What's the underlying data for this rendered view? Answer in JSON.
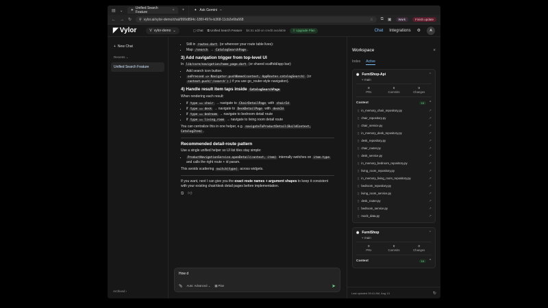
{
  "browser": {
    "tab_title": "Unified Search Feature",
    "new_tab": "+",
    "url": "vylor.ai/vylor-demo/chat/999d894c-186f-497e-b368-11cb2e6fa668",
    "gemini_label": "Ask Gemini",
    "profile_label": "Work",
    "update_label": "Finish update"
  },
  "header": {
    "logo": "Vylor",
    "workspace_initial": "V",
    "workspace_name": "vylor-demo",
    "chat_label": "Chat",
    "doc_title": "Unified Search Feature",
    "credit_text": "$4.51 add-on credit available",
    "upgrade_label": "Upgrade Plan",
    "nav_chat": "Chat",
    "nav_integrations": "Integrations",
    "avatar": "A"
  },
  "sidebar": {
    "new_chat": "New Chat",
    "recents": "Recents",
    "items": [
      "Unified Search Feature"
    ],
    "archived": "Archived"
  },
  "message": {
    "l1a": "Still in",
    "l1code": "routes.dart",
    "l1b": "(or wherever your route table lives):",
    "l2a": "Map",
    "l2code1": "/search",
    "l2arrow": "→",
    "l2code2": "CatalogSearchPage",
    "l2dot": ".",
    "h3": "3) Add navigation trigger from top-level UI",
    "p3a": "In",
    "p3code": "lib/core/navigation/home_page.dart",
    "p3b": "(or shared scaffold/app bar):",
    "li3a": "Add search icon button.",
    "li3b_code1": "onPressed => Navigator.pushNamed(context, AppRoutes.catalogSearch)",
    "li3b_a": "(or",
    "li3b_code2": "context.push('/search')",
    "li3b_b": ") if you use go_router-style navigation).",
    "h4a": "4) Handle result item taps inside",
    "h4code": "CatalogSearchPage",
    "p4": "When rendering each result:",
    "r1code": "type == chair",
    "r1a": "→ navigate to",
    "r1code2": "ChairDetailPage",
    "r1b": "with",
    "r1code3": "chairId",
    "r2code": "type == desk",
    "r2a": "→ navigate to",
    "r2code2": "DeskDetailPage",
    "r2b": "with",
    "r2code3": "deskId",
    "r3code": "type == bedroom",
    "r3a": "→ navigate to bedroom detail route",
    "r4code": "type == living_room",
    "r4a": "→ navigate to living room detail route",
    "p4b": "You can centralize this in one helper, e.g.",
    "p4code": "navigateToProductDetail(BuildContext, CatalogItem)",
    "h5": "Recommended detail-route pattern",
    "p5": "Use a single unified helper so UI list tiles stay simple:",
    "li5code": "ProductNavigationService.openDetail(context, item)",
    "li5a": "internally switches on",
    "li5code2": "item.type",
    "li5b": "and calls the right route + id param.",
    "p6a": "This avoids scattering",
    "p6code": "switch(type)",
    "p6b": "across widgets.",
    "p7a": "If you want, next I can give you the",
    "p7bold": "exact route names + argument shapes",
    "p7b": "to keep it consistent with your existing chair/desk detail pages before implementation.",
    "if": "if"
  },
  "composer": {
    "text": "How d",
    "mode_label": "Auto: Advanced",
    "plan_label": "Plan"
  },
  "workspace": {
    "title": "Workspace",
    "tabs": [
      "Index",
      "Active"
    ],
    "repo1": {
      "name": "FurniShop-Api",
      "branch": "main",
      "stats": [
        {
          "n": "0",
          "l": "PRs"
        },
        {
          "n": "0",
          "l": "Commits"
        },
        {
          "n": "0",
          "l": "Changes"
        }
      ],
      "context_label": "Context",
      "context_count": "16",
      "files": [
        "in_memory_chair_repository.py",
        "chair_repository.py",
        "chair_service.py",
        "in_memory_desk_repository.py",
        "desk_repository.py",
        "chair_router.py",
        "desk_service.py",
        "in_memory_bedroom_repository.py",
        "living_room_repository.py",
        "in_memory_living_room_repository.py",
        "bedroom_repository.py",
        "living_room_service.py",
        "desk_router.py",
        "bedroom_service.py",
        "mock_data.py"
      ]
    },
    "repo2": {
      "name": "FurniShop",
      "branch": "main",
      "stats": [
        {
          "n": "0",
          "l": "PRs"
        },
        {
          "n": "0",
          "l": "Commits"
        },
        {
          "n": "0",
          "l": "Changes"
        }
      ],
      "context_label": "Context",
      "context_count": "16"
    },
    "footer": "Last updated 05:41 AM, Aug 13"
  }
}
